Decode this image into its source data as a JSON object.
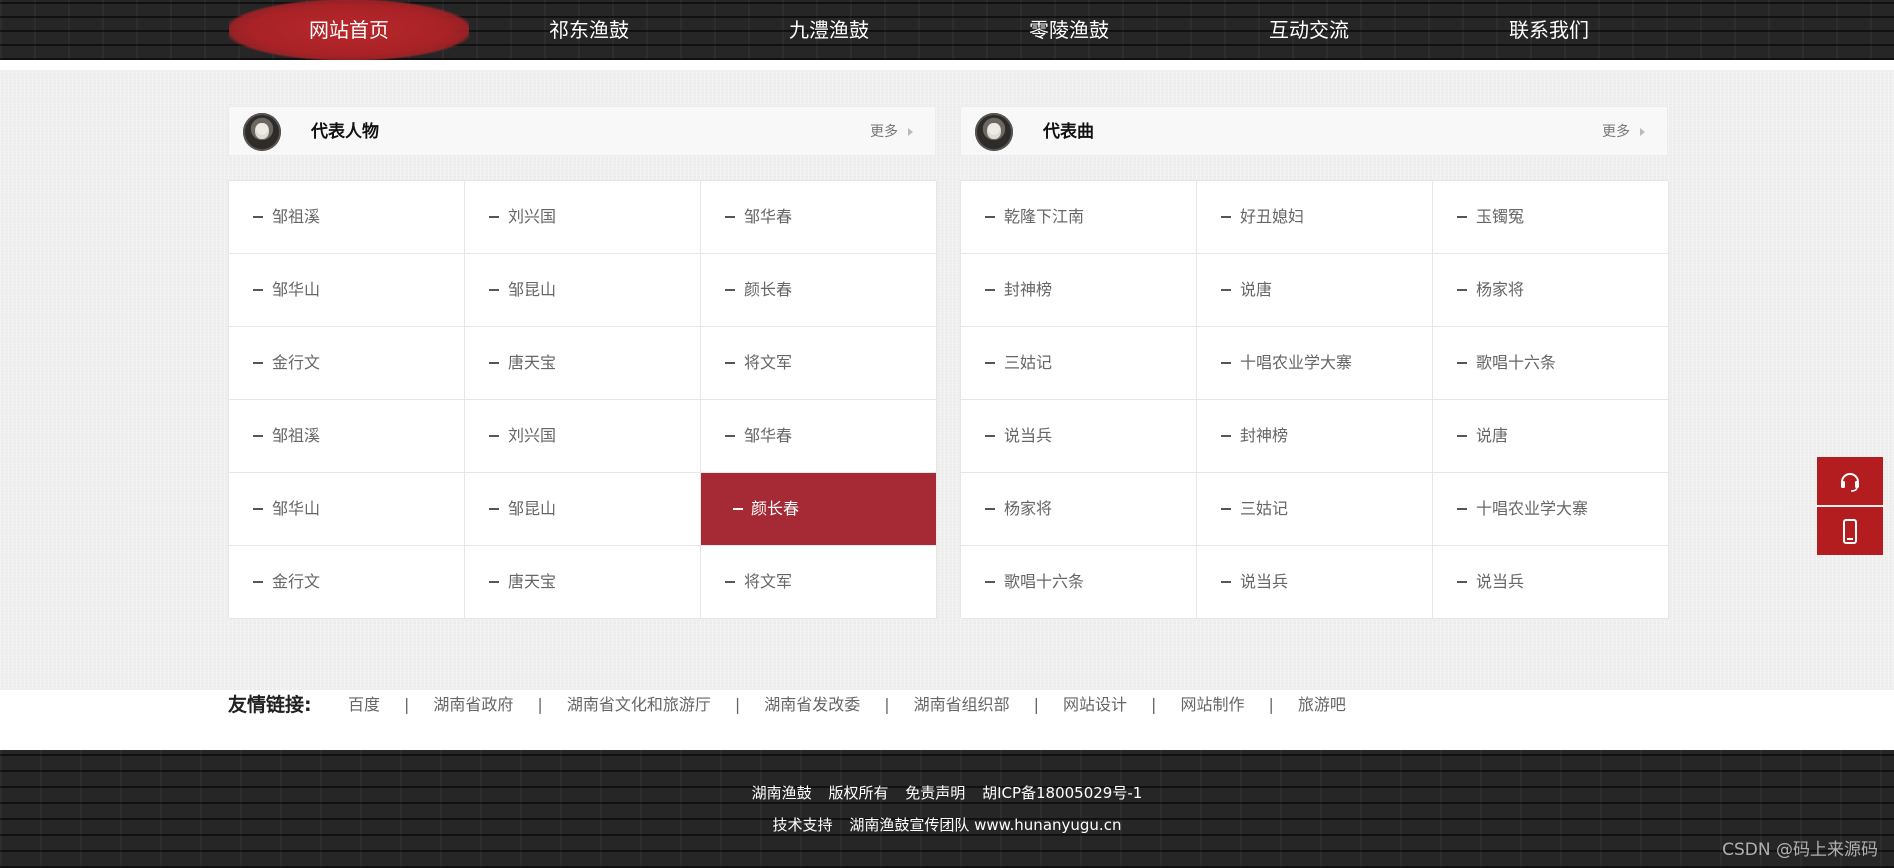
{
  "nav": {
    "items": [
      {
        "label": "网站首页",
        "active": true
      },
      {
        "label": "祁东渔鼓",
        "active": false
      },
      {
        "label": "九澧渔鼓",
        "active": false
      },
      {
        "label": "零陵渔鼓",
        "active": false
      },
      {
        "label": "互动交流",
        "active": false
      },
      {
        "label": "联系我们",
        "active": false
      }
    ]
  },
  "panels": {
    "people": {
      "title": "代表人物",
      "more_label": "更多",
      "active_index": 14,
      "items": [
        "邹祖溪",
        "刘兴国",
        "邹华春",
        "邹华山",
        "邹昆山",
        "颜长春",
        "金行文",
        "唐天宝",
        "将文军",
        "邹祖溪",
        "刘兴国",
        "邹华春",
        "邹华山",
        "邹昆山",
        "颜长春",
        "金行文",
        "唐天宝",
        "将文军"
      ]
    },
    "songs": {
      "title": "代表曲",
      "more_label": "更多",
      "items": [
        "乾隆下江南",
        "好丑媳妇",
        "玉镯冤",
        "封神榜",
        "说唐",
        "杨家将",
        "三姑记",
        "十唱农业学大寨",
        "歌唱十六条",
        "说当兵",
        "封神榜",
        "说唐",
        "杨家将",
        "三姑记",
        "十唱农业学大寨",
        "歌唱十六条",
        "说当兵",
        "说当兵"
      ]
    }
  },
  "float_buttons": {
    "customer_service_icon": "headset-icon",
    "mobile_icon": "mobile-phone-icon",
    "color": "#b31d20"
  },
  "links": {
    "title": "友情链接:",
    "separator": "|",
    "items": [
      "百度",
      "湖南省政府",
      "湖南省文化和旅游厅",
      "湖南省发改委",
      "湖南省组织部",
      "网站设计",
      "网站制作",
      "旅游吧"
    ]
  },
  "footer": {
    "line1": [
      "湖南渔鼓",
      "版权所有",
      "免责声明",
      "胡ICP备18005029号-1"
    ],
    "line2": [
      "技术支持",
      "湖南渔鼓宣传团队 www.hunanyugu.cn"
    ]
  },
  "watermark": "CSDN @码上来源码",
  "colors": {
    "accent": "#a52a35",
    "nav_active": "#a82326",
    "dark_bg": "#262626",
    "main_bg": "#efefef"
  }
}
